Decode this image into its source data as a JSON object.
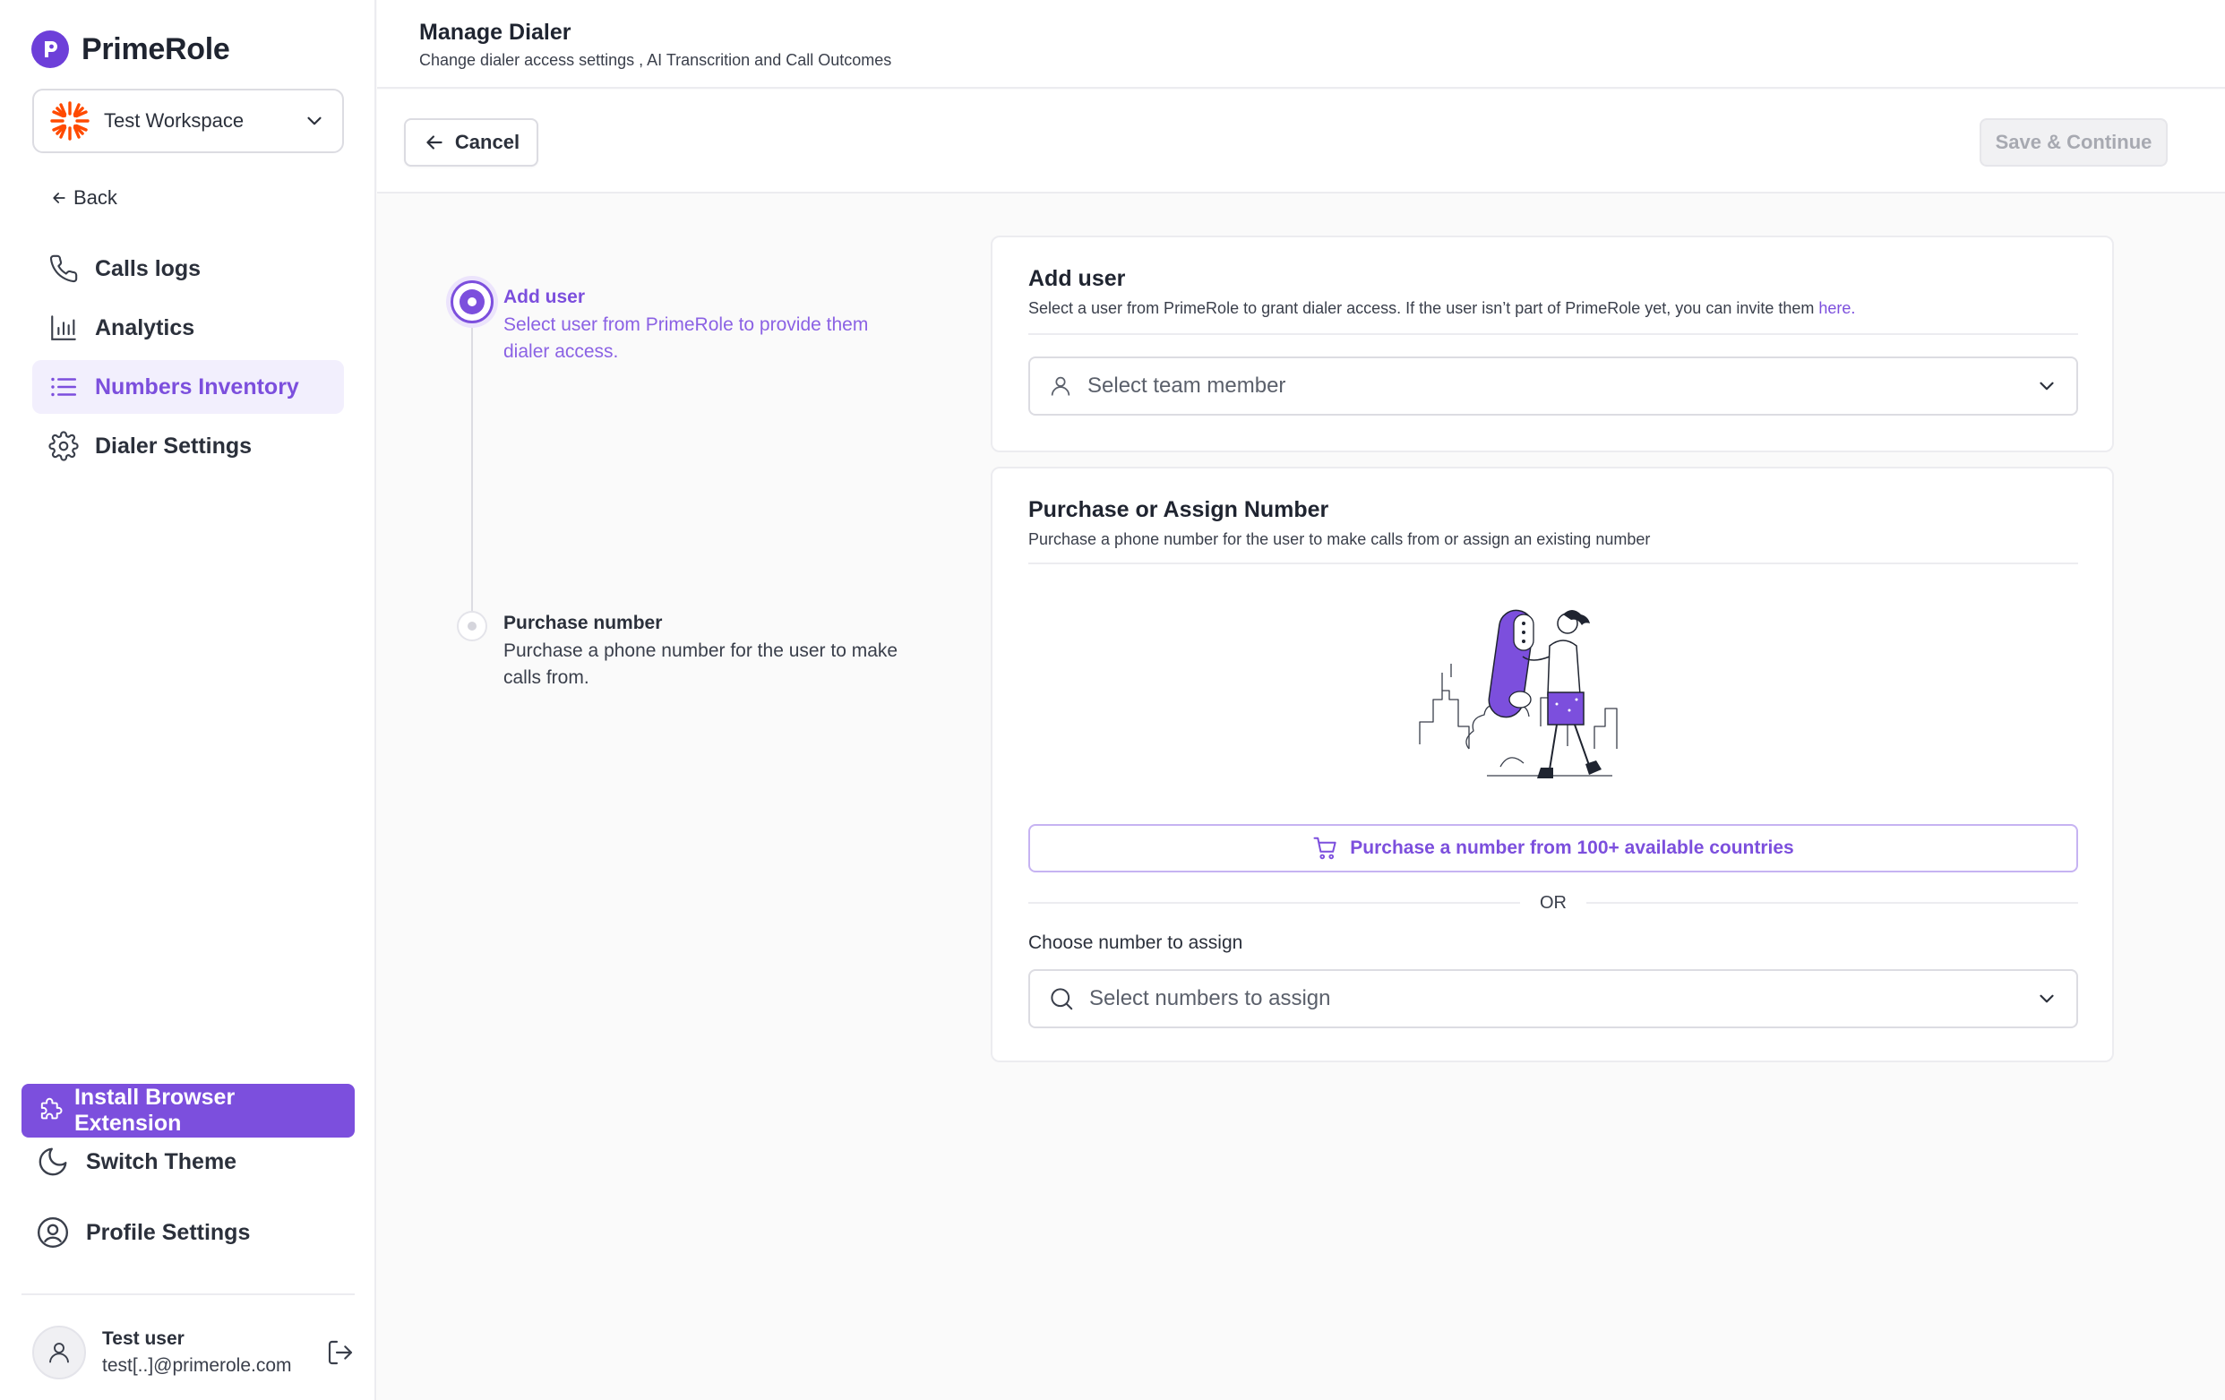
{
  "app": {
    "brand_name": "PrimeRole",
    "accent_color": "#7c4fdd"
  },
  "sidebar": {
    "workspace_name": "Test Workspace",
    "back_label": "Back",
    "nav": [
      {
        "label": "Calls logs",
        "icon": "phone-icon",
        "active": false
      },
      {
        "label": "Analytics",
        "icon": "bar-chart-icon",
        "active": false
      },
      {
        "label": "Numbers Inventory",
        "icon": "list-icon",
        "active": true
      },
      {
        "label": "Dialer Settings",
        "icon": "gear-icon",
        "active": false
      }
    ],
    "install_extension_label": "Install Browser Extension",
    "switch_theme_label": "Switch Theme",
    "profile_settings_label": "Profile Settings",
    "user": {
      "name": "Test user",
      "email": "test[..]@primerole.com"
    }
  },
  "header": {
    "title": "Manage Dialer",
    "subtitle": "Change dialer access settings , AI Transcrition and Call Outcomes"
  },
  "toolbar": {
    "cancel_label": "Cancel",
    "save_label": "Save & Continue"
  },
  "stepper": {
    "steps": [
      {
        "title": "Add user",
        "description": "Select user from PrimeRole to provide them dialer access.",
        "state": "active"
      },
      {
        "title": "Purchase number",
        "description": "Purchase a phone number for the user to make calls from.",
        "state": "pending"
      }
    ]
  },
  "add_user_card": {
    "title": "Add user",
    "description": "Select a user from PrimeRole to grant dialer access. If the user isn’t part of PrimeRole yet, you can invite them",
    "invite_link": "here.",
    "select_placeholder": "Select team member"
  },
  "purchase_card": {
    "title": "Purchase or Assign Number",
    "description": "Purchase a phone number for the user to make calls from or assign an existing number",
    "purchase_button_label": "Purchase a number from 100+ available countries",
    "or_label": "OR",
    "assign_label": "Choose number to assign",
    "assign_placeholder": "Select numbers to assign"
  }
}
